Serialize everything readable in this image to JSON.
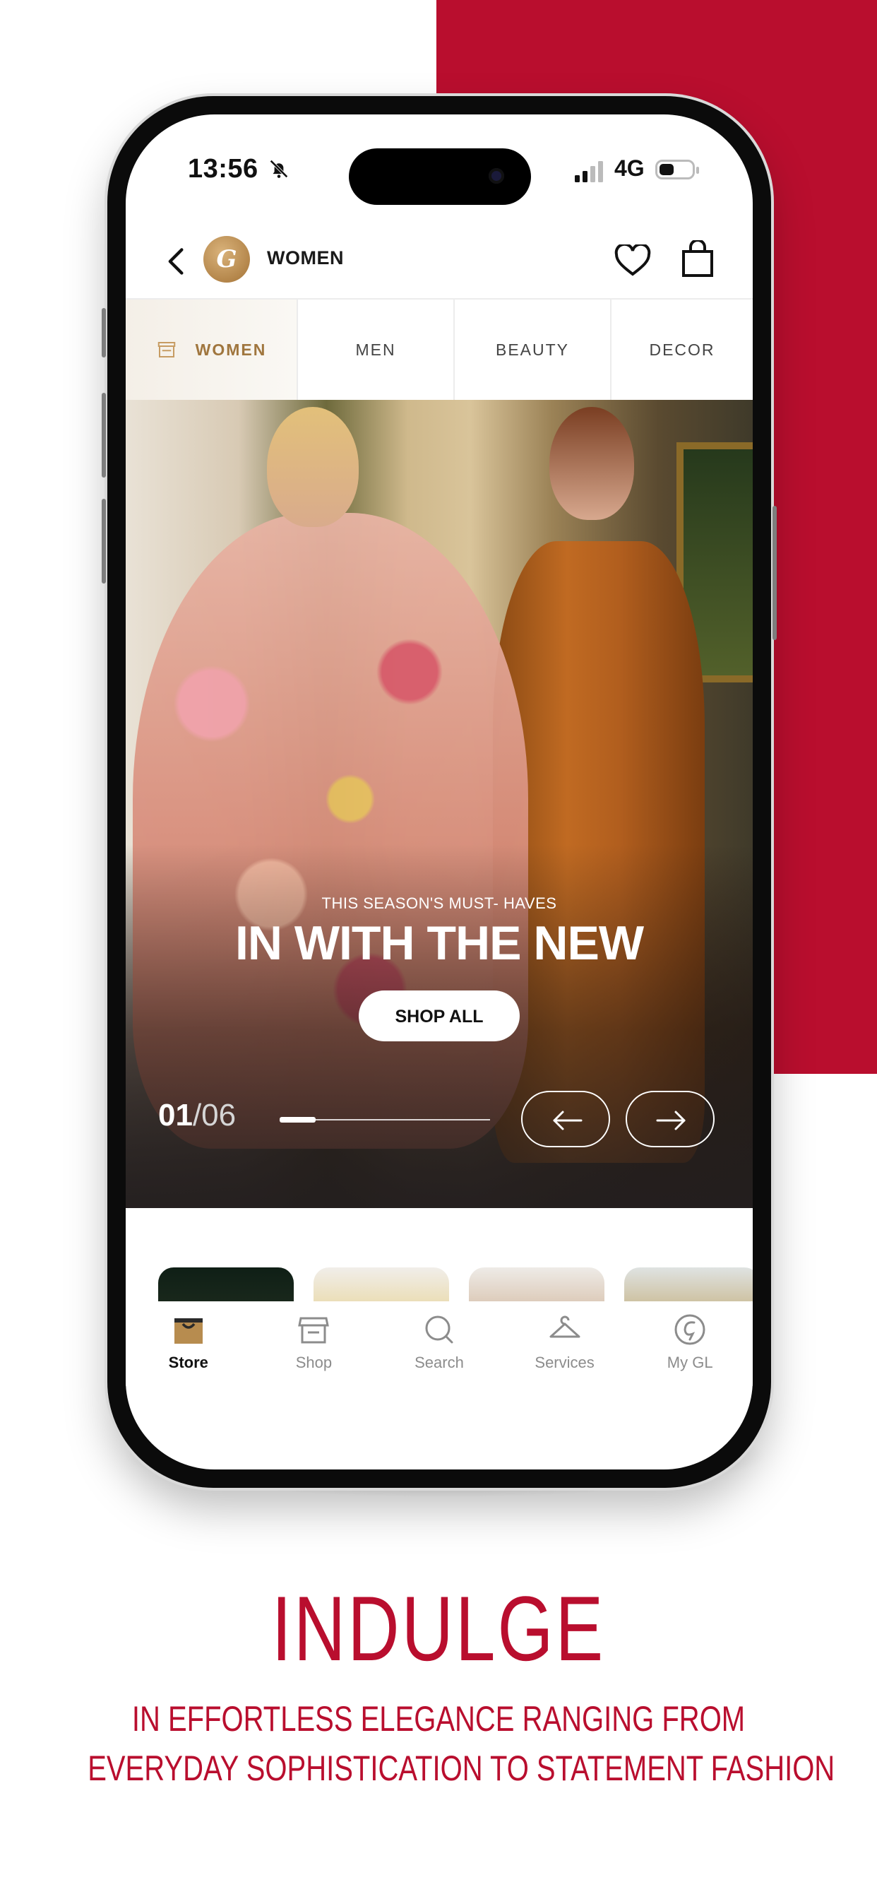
{
  "status_bar": {
    "time": "13:56",
    "network": "4G",
    "icons": [
      "bell-muted-icon",
      "signal-icon",
      "battery-icon"
    ]
  },
  "header": {
    "back_icon": "chevron-left-icon",
    "logo_icon": "gl-monogram-logo",
    "title": "WOMEN",
    "wishlist_icon": "heart-icon",
    "cart_icon": "shopping-bag-icon"
  },
  "category_tabs": [
    {
      "label": "WOMEN",
      "active": true,
      "icon": "storefront-icon"
    },
    {
      "label": "MEN",
      "active": false
    },
    {
      "label": "BEAUTY",
      "active": false
    },
    {
      "label": "DECOR",
      "active": false
    }
  ],
  "hero": {
    "eyebrow": "THIS SEASON'S MUST- HAVES",
    "headline": "IN WITH THE NEW",
    "cta": "SHOP ALL",
    "slide_current": "01",
    "slide_total": "/06",
    "slide_progress": 0.17,
    "prev_icon": "arrow-left-icon",
    "next_icon": "arrow-right-icon"
  },
  "bottom_nav": [
    {
      "label": "Store",
      "icon": "store-bag-icon",
      "active": true
    },
    {
      "label": "Shop",
      "icon": "storefront-icon",
      "active": false
    },
    {
      "label": "Search",
      "icon": "search-icon",
      "active": false
    },
    {
      "label": "Services",
      "icon": "hanger-icon",
      "active": false
    },
    {
      "label": "My GL",
      "icon": "gl-monogram-icon",
      "active": false
    }
  ],
  "promo": {
    "title": "INDULGE",
    "line1": "IN EFFORTLESS ELEGANCE RANGING FROM",
    "line2": "EVERYDAY SOPHISTICATION TO STATEMENT FASHION"
  },
  "colors": {
    "brand_red": "#b90e2e",
    "gold_accent": "#a0763e"
  }
}
